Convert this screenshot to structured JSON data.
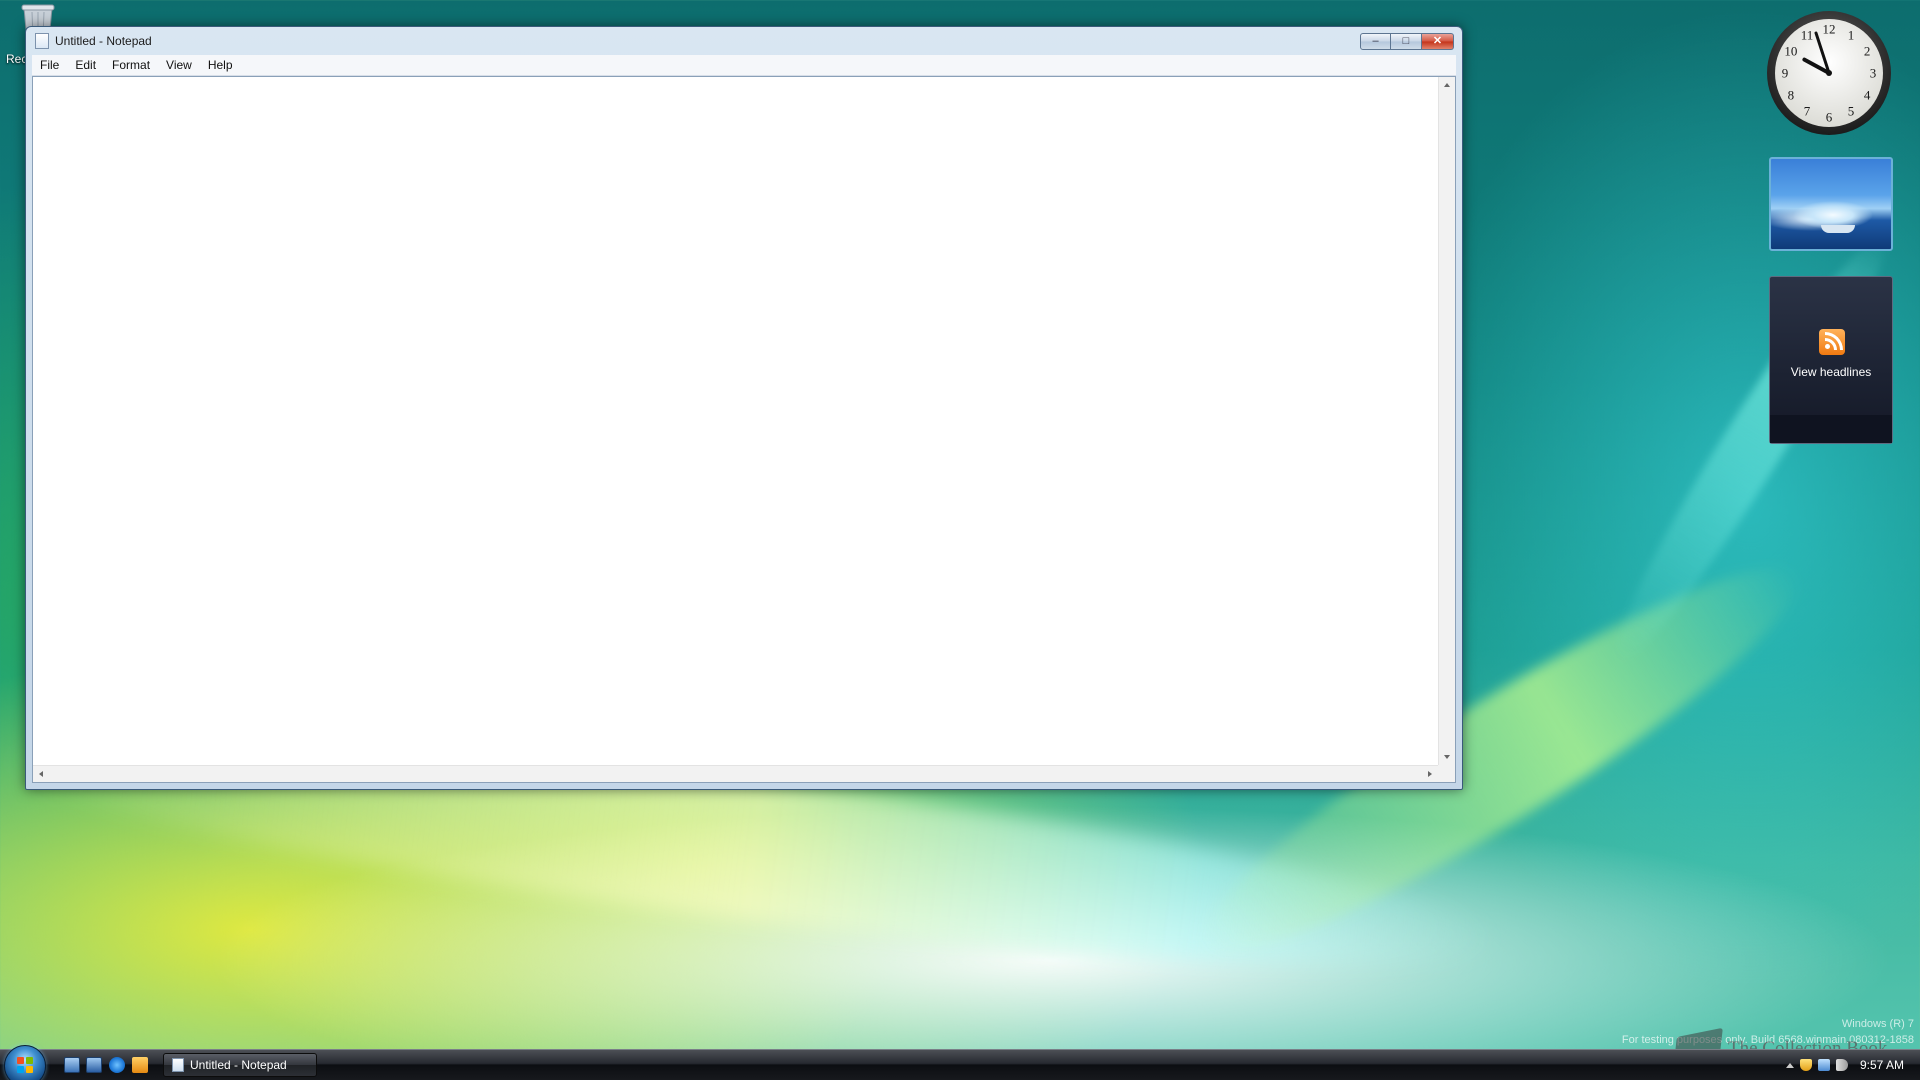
{
  "desktop": {
    "recycle_bin_label": "Rec"
  },
  "notepad": {
    "title": "Untitled - Notepad",
    "menu": [
      "File",
      "Edit",
      "Format",
      "View",
      "Help"
    ],
    "content": "",
    "buttons": {
      "minimize": "–",
      "maximize": "□",
      "close": "✕"
    }
  },
  "gadgets": {
    "clock": {
      "numbers": [
        "12",
        "1",
        "2",
        "3",
        "4",
        "5",
        "6",
        "7",
        "8",
        "9",
        "10",
        "11"
      ],
      "hour": 9,
      "minute": 57
    },
    "feeds": {
      "label": "View headlines"
    }
  },
  "watermark": {
    "line1": "Windows (R) 7",
    "line2": "For testing purposes only. Build 6568.winmain.080312-1858",
    "collection_text": "The Collection Book"
  },
  "taskbar": {
    "active_task": "Untitled - Notepad",
    "time": "9:57 AM"
  },
  "colors": {
    "close_button": "#c33218",
    "accent_blue": "#3e8fd0",
    "rss_orange": "#f07a11"
  }
}
